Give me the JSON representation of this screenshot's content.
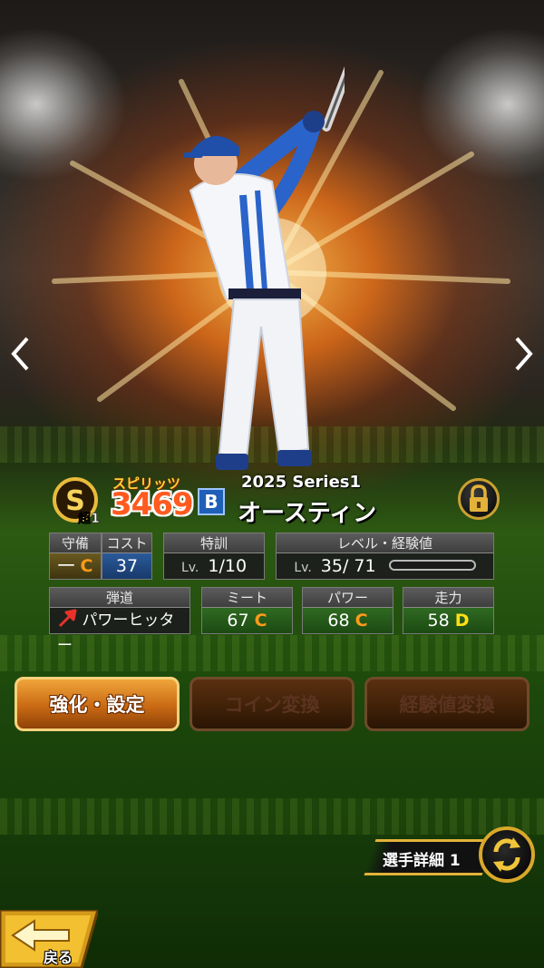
{
  "player": {
    "spirits_label": "スピリッツ",
    "spirits_value": "3469",
    "rank_letter": "S",
    "rank_sub": "超1",
    "team_logo_letter": "B",
    "series": "2025 Series1",
    "name": "オースティン"
  },
  "stats": {
    "defense": {
      "label": "守備",
      "value": "一",
      "grade": "C"
    },
    "cost": {
      "label": "コスト",
      "value": "37"
    },
    "training": {
      "label": "特訓",
      "lv_prefix": "Lv.",
      "value": "1/10"
    },
    "level": {
      "label": "レベル・経験値",
      "lv_prefix": "Lv.",
      "current": "35",
      "separator": "/",
      "max": "71",
      "exp_fraction": 0.0
    },
    "trajectory": {
      "label": "弾道",
      "value": "パワーヒッター"
    },
    "meet": {
      "label": "ミート",
      "value": "67",
      "grade": "C"
    },
    "power": {
      "label": "パワー",
      "value": "68",
      "grade": "C"
    },
    "speed": {
      "label": "走力",
      "value": "58",
      "grade": "D"
    }
  },
  "actions": {
    "enhance": "強化・設定",
    "coin_exchange": "コイン変換",
    "exp_exchange": "経験値変換"
  },
  "footer": {
    "detail_label": "選手詳細 1",
    "back_label": "戻る"
  },
  "icons": {
    "left": "chevron-left-icon",
    "right": "chevron-right-icon",
    "lock": "lock-icon",
    "swap": "swap-icon",
    "trajectory": "arrow-up-right-icon"
  },
  "colors": {
    "spirits": "#ff5a1f",
    "grade_c": "#ff9a1a",
    "grade_d": "#ffe014",
    "gold": "#d9a82a",
    "button_orange": "#e08a24"
  }
}
